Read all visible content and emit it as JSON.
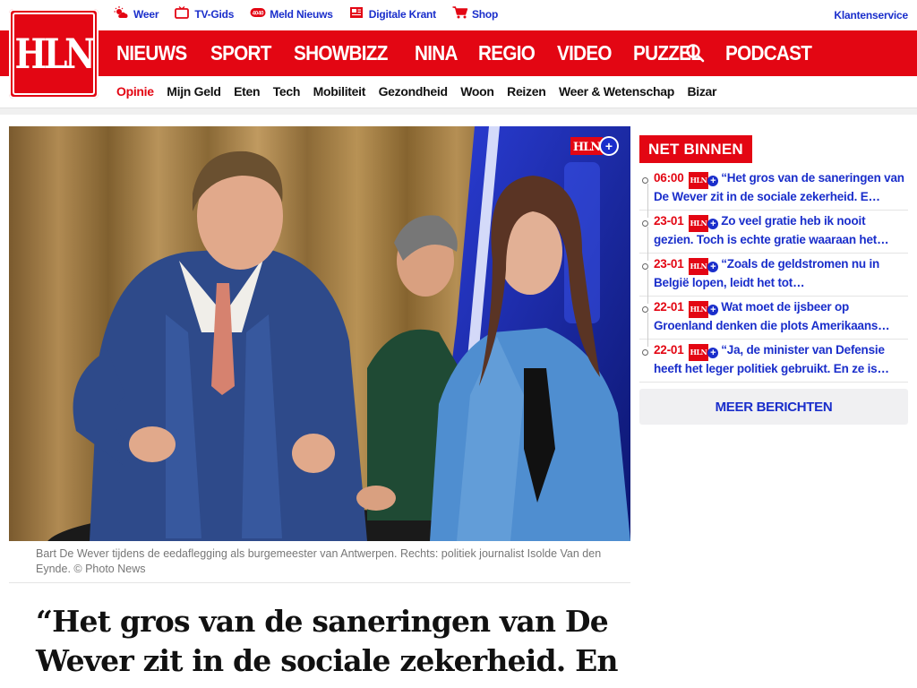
{
  "brand": {
    "logo_text": "HLN",
    "primary_color": "#e30613",
    "link_color": "#1a2ecb"
  },
  "utility": {
    "links": [
      {
        "label": "Weer",
        "icon": "weather-icon"
      },
      {
        "label": "TV-Gids",
        "icon": "tv-icon"
      },
      {
        "label": "Meld Nieuws",
        "icon": "phone-icon"
      },
      {
        "label": "Digitale Krant",
        "icon": "newspaper-icon"
      },
      {
        "label": "Shop",
        "icon": "cart-icon"
      }
    ],
    "customer_service": "Klantenservice"
  },
  "main_nav": [
    "NIEUWS",
    "SPORT",
    "SHOWBIZZ",
    "NINA",
    "REGIO",
    "VIDEO",
    "PUZZEL",
    "PODCAST"
  ],
  "sub_nav": {
    "active": "Opinie",
    "items": [
      "Opinie",
      "Mijn Geld",
      "Eten",
      "Tech",
      "Mobiliteit",
      "Gezondheid",
      "Woon",
      "Reizen",
      "Weer & Wetenschap",
      "Bizar"
    ]
  },
  "article": {
    "image_badge": "HLN",
    "caption": "Bart De Wever tijdens de eedaflegging als burgemeester van Antwerpen. Rechts: politiek journalist Isolde Van den Eynde. © Photo News",
    "headline": "“Het gros van de saneringen van De Wever zit in de sociale zekerheid. En"
  },
  "net_binnen": {
    "title": "NET BINNEN",
    "items": [
      {
        "time": "06:00",
        "badge": "HLN",
        "text": "“Het gros van de saneringen van De Wever zit in de sociale zekerheid. E…"
      },
      {
        "time": "23-01",
        "badge": "HLN",
        "text": "Zo veel gratie heb ik nooit gezien. Toch is echte gratie waaraan het…"
      },
      {
        "time": "23-01",
        "badge": "HLN",
        "text": "“Zoals de geldstromen nu in België lopen, leidt het tot…"
      },
      {
        "time": "22-01",
        "badge": "HLN",
        "text": "Wat moet de ijsbeer op Groenland denken die plots Amerikaans…"
      },
      {
        "time": "22-01",
        "badge": "HLN",
        "text": "“Ja, de minister van Defensie heeft het leger politiek gebruikt. En ze is…"
      }
    ],
    "more_label": "MEER BERICHTEN"
  }
}
